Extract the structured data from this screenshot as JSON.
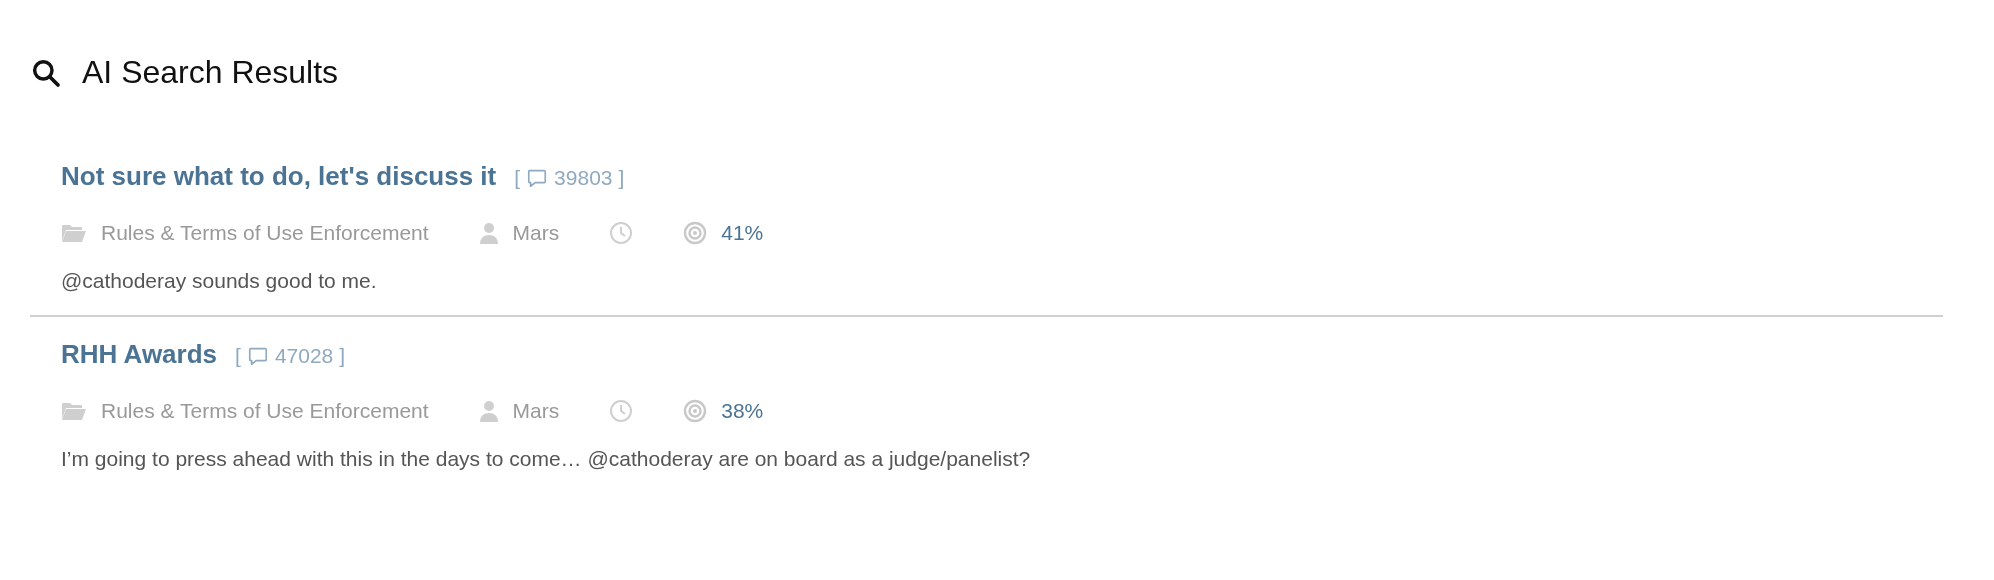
{
  "header": {
    "title": "AI Search Results"
  },
  "results": [
    {
      "title": "Not sure what to do, let's discuss it",
      "replies": {
        "open": "[",
        "count": "39803",
        "close": "]"
      },
      "category": "Rules & Terms of Use Enforcement",
      "author": "Mars",
      "score": "41%",
      "excerpt": "@cathoderay sounds good to me."
    },
    {
      "title": "RHH Awards",
      "replies": {
        "open": "[",
        "count": "47028",
        "close": "]"
      },
      "category": "Rules & Terms of Use Enforcement",
      "author": "Mars",
      "score": "38%",
      "excerpt": "I’m going to press ahead with this in the days to come… @cathoderay are on board as a judge/panelist?"
    }
  ]
}
